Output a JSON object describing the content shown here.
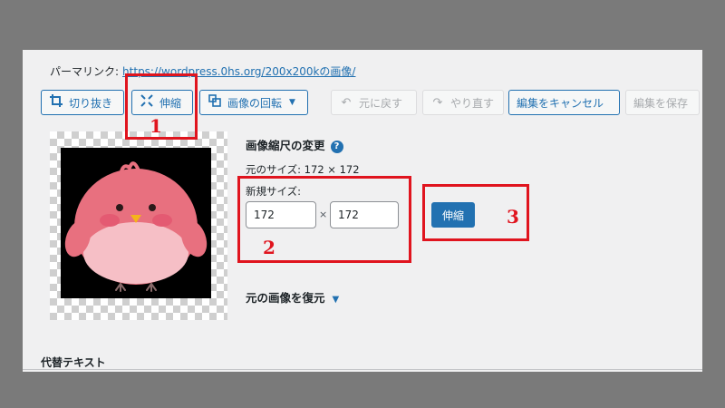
{
  "permalink": {
    "label": "パーマリンク:",
    "url": "https://wordpress.0hs.org/200x200kの画像/"
  },
  "toolbar": {
    "crop_label": "切り抜き",
    "scale_label": "伸縮",
    "rotate_label": "画像の回転",
    "undo_label": "元に戻す",
    "redo_label": "やり直す",
    "cancel_label": "編集をキャンセル",
    "save_label": "編集を保存"
  },
  "scale": {
    "title": "画像縮尺の変更",
    "help_icon": "?",
    "original_size": "元のサイズ: 172 × 172",
    "new_size_label": "新規サイズ:",
    "width": "172",
    "height": "172",
    "times": "×",
    "submit_label": "伸縮"
  },
  "restore": {
    "label": "元の画像を復元"
  },
  "alt_text_label": "代替テキスト",
  "annotations": [
    "1",
    "2",
    "3"
  ],
  "icons": {
    "crop": "crop-icon",
    "scale": "scale-icon",
    "rotate": "rotate-icon",
    "undo": "undo-icon",
    "redo": "redo-icon",
    "help": "help-icon",
    "restore_caret": "caret-down-icon"
  },
  "colors": {
    "accent": "#2271b1",
    "annotation": "#e0141e",
    "panel_bg": "#f0f0f1",
    "backdrop": "#7a7a7a"
  },
  "image": {
    "subject": "pink chick illustration",
    "background": "#000000"
  }
}
